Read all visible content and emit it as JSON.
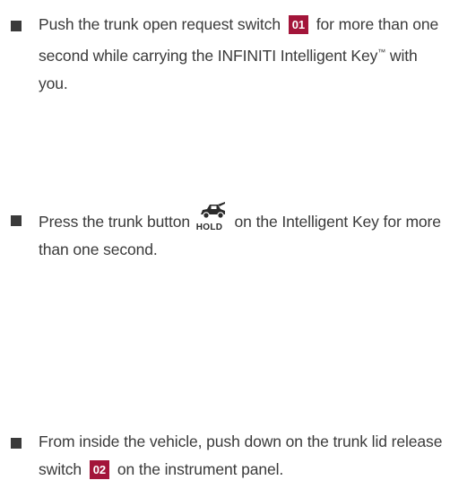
{
  "items": [
    {
      "before": "Push the trunk open request switch",
      "badge": "01",
      "after": "for more than one second while carrying the INFINITI Intelligent Key",
      "trademark": "™",
      "after2": " with you."
    },
    {
      "before": "Press the trunk button",
      "icon": "trunk-open-car-icon",
      "icon_label": "HOLD",
      "after": "on the Intelligent Key for more than one second."
    },
    {
      "before": "From inside the vehicle, push down on the trunk lid release switch",
      "badge": "02",
      "after": "on the instrument panel."
    }
  ],
  "colors": {
    "badge_bg": "#a3153a",
    "text": "#3a3a3a"
  }
}
